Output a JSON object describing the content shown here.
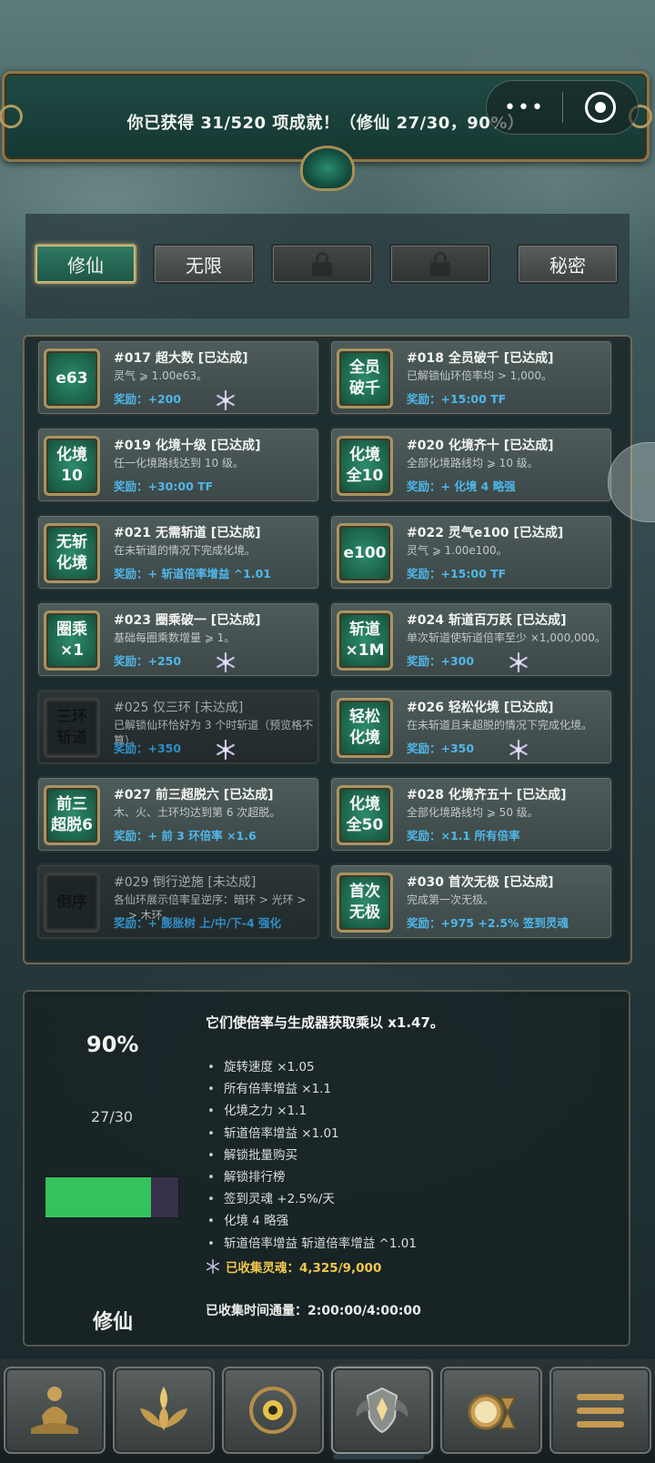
{
  "header": {
    "achievement_summary": "你已获得 31/520 项成就！（修仙 27/30，90%）",
    "more_menu_label": "•••"
  },
  "tabs": [
    {
      "label": "修仙",
      "state": "active"
    },
    {
      "label": "无限",
      "state": "normal"
    },
    {
      "label": "",
      "state": "locked"
    },
    {
      "label": "",
      "state": "locked"
    },
    {
      "label": "秘密",
      "state": "normal"
    }
  ],
  "achievements": [
    {
      "badge": "e63",
      "title": "#017 超大数 [已达成]",
      "desc": "灵气 ⩾ 1.00e63。",
      "reward": "奖励：+200",
      "snowflake": true,
      "achieved": true
    },
    {
      "badge": "全员\n破千",
      "title": "#018 全员破千 [已达成]",
      "desc": "已解锁仙环倍率均 > 1,000。",
      "reward": "奖励：+15:00 TF",
      "snowflake": false,
      "achieved": true
    },
    {
      "badge": "化境\n10",
      "title": "#019 化境十级 [已达成]",
      "desc": "任一化境路线达到 10 级。",
      "reward": "奖励：+30:00 TF",
      "snowflake": false,
      "achieved": true
    },
    {
      "badge": "化境\n全10",
      "title": "#020 化境齐十 [已达成]",
      "desc": "全部化境路线均 ⩾ 10 级。",
      "reward": "奖励：+ 化境 4 略强",
      "snowflake": false,
      "achieved": true
    },
    {
      "badge": "无斩\n化境",
      "title": "#021 无需斩道 [已达成]",
      "desc": "在未斩道的情况下完成化境。",
      "reward": "奖励：+ 斩道倍率增益 ^1.01",
      "snowflake": false,
      "achieved": true
    },
    {
      "badge": "e100",
      "title": "#022 灵气e100 [已达成]",
      "desc": "灵气 ⩾ 1.00e100。",
      "reward": "奖励：+15:00 TF",
      "snowflake": false,
      "achieved": true
    },
    {
      "badge": "圈乘\n×1",
      "title": "#023 圈乘破一 [已达成]",
      "desc": "基础每圈乘数增量 ⩾ 1。",
      "reward": "奖励：+250",
      "snowflake": true,
      "achieved": true
    },
    {
      "badge": "斩道\n×1M",
      "title": "#024 斩道百万跃 [已达成]",
      "desc": "单次斩道使斩道倍率至少 ×1,000,000。",
      "reward": "奖励：+300",
      "snowflake": true,
      "achieved": true
    },
    {
      "badge": "三环\n斩道",
      "title": "#025 仅三环 [未达成]",
      "desc": "已解锁仙环恰好为 3 个时斩道（预览格不算）。",
      "reward": "奖励：+350",
      "snowflake": true,
      "achieved": false
    },
    {
      "badge": "轻松\n化境",
      "title": "#026 轻松化境 [已达成]",
      "desc": "在未斩道且未超脱的情况下完成化境。",
      "reward": "奖励：+350",
      "snowflake": true,
      "achieved": true
    },
    {
      "badge": "前三\n超脱6",
      "title": "#027 前三超脱六 [已达成]",
      "desc": "木、火、土环均达到第 6 次超脱。",
      "reward": "奖励：+ 前 3 环倍率 ×1.6",
      "snowflake": false,
      "achieved": true
    },
    {
      "badge": "化境\n全50",
      "title": "#028 化境齐五十 [已达成]",
      "desc": "全部化境路线均 ⩾ 50 级。",
      "reward": "奖励：×1.1 所有倍率",
      "snowflake": false,
      "achieved": true
    },
    {
      "badge": "倒序",
      "title": "#029 倒行逆施 [未达成]",
      "desc": "各仙环展示倍率呈逆序：暗环 > 光环 > … > 木环。",
      "reward": "奖励：+ 膨胀树 上/中/下-4 强化",
      "snowflake": false,
      "achieved": false
    },
    {
      "badge": "首次\n无极",
      "title": "#030 首次无极 [已达成]",
      "desc": "完成第一次无极。",
      "reward": "奖励：+975 +2.5% 签到灵魂",
      "snowflake": false,
      "achieved": true
    }
  ],
  "stats": {
    "percent": "90%",
    "fraction": "27/30",
    "progress": 0.9,
    "category_name": "修仙",
    "heading": "它们使倍率与生成器获取乘以 x1.47。",
    "bullets": [
      "旋转速度 ×1.05",
      "所有倍率增益 ×1.1",
      "化境之力 ×1.1",
      "斩道倍率增益 ×1.01",
      "解锁批量购买",
      "解锁排行榜",
      "签到灵魂 +2.5%/天",
      "化境 4 略强",
      "斩道倍率增益 斩道倍率增益 ^1.01"
    ],
    "souls_collected": "已收集灵魂：4,325/9,000",
    "time_flow": "已收集时间通量：2:00:00/4:00:00"
  },
  "nav": [
    {
      "icon": "meditating-buddha-icon"
    },
    {
      "icon": "lotus-flame-icon"
    },
    {
      "icon": "bagua-orb-icon"
    },
    {
      "icon": "winged-shield-icon",
      "active": true
    },
    {
      "icon": "compass-hourglass-icon"
    },
    {
      "icon": "menu-lines-icon"
    }
  ],
  "colors": {
    "reward_blue": "#4fb7ea",
    "souls_gold": "#f0c84a",
    "progress_green": "#34c25c",
    "badge_green": "#1b6149"
  }
}
